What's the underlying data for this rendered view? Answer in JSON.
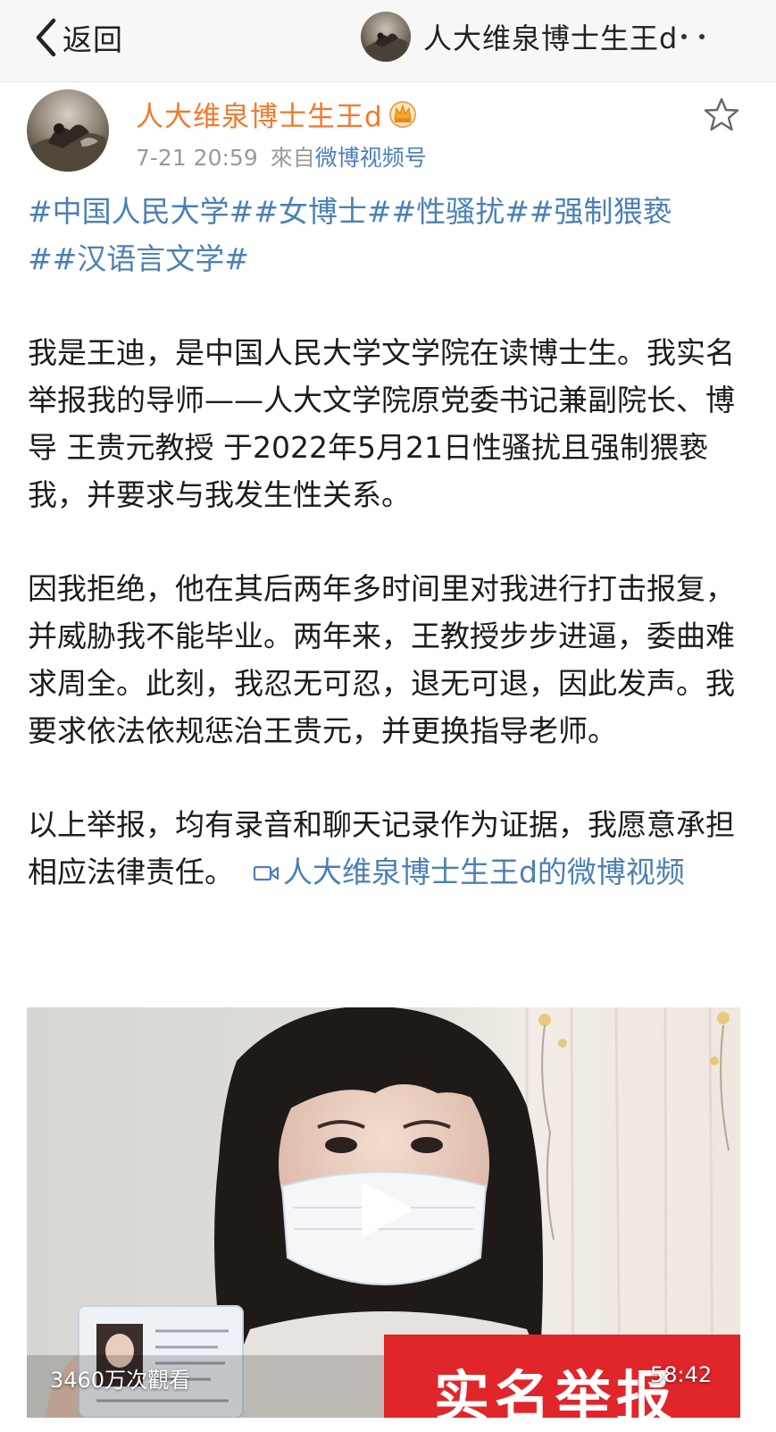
{
  "nav": {
    "back_label": "返回",
    "title": "人大维泉博士生王d"
  },
  "post": {
    "author": "人大维泉博士生王d",
    "timestamp": "7-21 20:59",
    "source_prefix": "來自",
    "source": "微博视频号",
    "hashtags": [
      "#中国人民大学##女博士##性骚扰##强制猥亵",
      "##汉语言文学#"
    ],
    "paragraphs": [
      "我是王迪，是中国人民大学文学院在读博士生。我实名举报我的导师——人大文学院原党委书记兼副院长、博导 王贵元教授 于2022年5月21日性骚扰且强制猥亵我，并要求与我发生性关系。",
      "因我拒绝，他在其后两年多时间里对我进行打击报复，并威胁我不能毕业。两年来，王教授步步进逼，委曲难求周全。此刻，我忍无可忍，退无可退，因此发声。我要求依法依规惩治王贵元，并更换指导老师。",
      "以上举报，均有录音和聊天记录作为证据，我愿意承担相应法律责任。"
    ],
    "video_link": "人大维泉博士生王d的微博视频"
  },
  "video": {
    "view_count": "3460万次觀看",
    "duration": "58:42",
    "banner_text": "实名举报"
  },
  "colors": {
    "link_blue": "#4c80b5",
    "author_orange": "#f2782a",
    "banner_red": "#e0262a"
  },
  "icons": [
    "chevron-left-icon",
    "more-icon",
    "crown-icon",
    "star-icon",
    "video-camera-icon",
    "play-icon"
  ]
}
